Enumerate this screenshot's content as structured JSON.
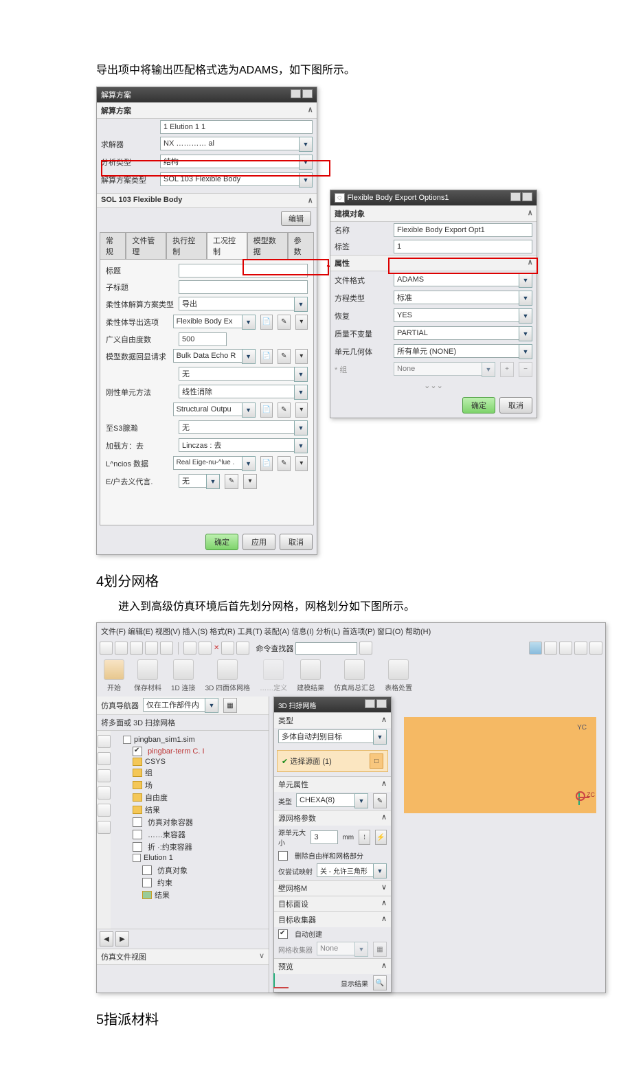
{
  "doc": {
    "intro": "导出项中将输出匹配格式选为ADAMS，如下图所示。",
    "h2_mesh": "4划分网格",
    "mesh_para": "进入到高级仿真环境后首先划分网格，网格划分如下图所示。",
    "h2_mat": "5指派材料"
  },
  "dlg1": {
    "title": "解算方案",
    "section": "解算方案",
    "nameField": "1 Elution 1  1",
    "solverLbl": "求解器",
    "solver": "NX ………… al",
    "analysisTypeLbl": "分析类型",
    "analysisType": "结构",
    "solutionTypeLbl": "解算方案类型",
    "solutionType": "SOL 103 Flexible Body",
    "sectionSol": "SOL 103 Flexible Body",
    "editBtn": "编辑",
    "tabs": [
      "常规",
      "文件管理",
      "执行控制",
      "工况控制",
      "模型数据",
      "参数"
    ],
    "activeTab": "工况控制",
    "rows": {
      "titleLbl": "标题",
      "subtitleLbl": "子标题",
      "flexSolTypeLbl": "柔性体解算方案类型",
      "flexSolType": "导出",
      "flexExportLbl": "柔性体导出选项",
      "flexExport": "Flexible Body Ex",
      "gdofLbl": "广义自由度数",
      "gdof": "500",
      "bulkEchoLbl": "模型数据回显请求",
      "bulkEcho": "Bulk Data Echo R",
      "none1": "无",
      "rigidElemLbl": "刚性单元方法",
      "rigidElem": "线性消除",
      "structOut": "Structural Outpu",
      "none2": "无",
      "toS3Lbl": "至S3腺瀚",
      "addMethodLbl": "加载方：去",
      "addMethod": "Linczas : 去",
      "lanczosLbl": "L^ncios 数据",
      "lanczos": "Real Eige-nu-^lue .",
      "userDefLbl": "E/户去义代言.",
      "none3": "无"
    },
    "footer": {
      "ok": "确定",
      "apply": "应用",
      "cancel": "取消"
    }
  },
  "dlg2": {
    "title": "Flexible Body Export Options1",
    "section_model": "建模对象",
    "nameLbl": "名称",
    "name": "Flexible Body Export Opt1",
    "labelLbl": "标签",
    "label": "1",
    "section_attr": "属性",
    "fileFmtLbl": "文件格式",
    "fileFmt": "ADAMS",
    "eqTypeLbl": "方程类型",
    "eqType": "标准",
    "recoverLbl": "恢复",
    "recover": "YES",
    "massInvLbl": "质量不变量",
    "massInv": "PARTIAL",
    "elemGeomLbl": "单元几何体",
    "elemGeom": "所有单元 (NONE)",
    "groupLbl": "* 组",
    "group": "None",
    "footer": {
      "ok": "确定",
      "cancel": "取消"
    }
  },
  "fig2": {
    "menubar": "文件(F)  编辑(E)  视图(V)  插入(S)  格式(R)  工具(T)  装配(A)  信息(I)  分析(L)  首选项(P)  窗口(O)  帮助(H)",
    "searchLbl": "命令查找器",
    "ribbon": [
      "开始",
      "保存材料",
      "1D 连接",
      "3D 四面体网格",
      "……定义",
      "建模结果",
      "仿真局总汇总",
      "表格处置"
    ],
    "filterLbl": "仿真导航器",
    "filterCombo": "仅在工作部件内",
    "treeTitle": "将多面或 3D 扫掠网格",
    "tree": {
      "root": "pingban_sim1.sim",
      "fem": "pingbar-term C.  I",
      "items": [
        "CSYS",
        "组",
        "场",
        "自由度",
        "结果",
        "仿真对象容器",
        "……束容器",
        "折 ·:约束容器"
      ],
      "sol": "Elution 1",
      "solChildren": [
        "仿真对象",
        "约束",
        "结果"
      ]
    },
    "bottom": "仿真文件视图",
    "meshDlg": {
      "title": "3D 扫掠网格",
      "typeSec": "类型",
      "typeVal": "多体自动判别目标",
      "selSec": "选择源面 (1)",
      "elemSec": "单元属性",
      "elemTypeLbl": "类型",
      "elemType": "CHEXA(8)",
      "paramSec": "源网格参数",
      "sizeLbl": "源单元大小",
      "size": "3",
      "unit": "mm",
      "chk1": "删除自由样和网格部分",
      "onlyTryLbl": "仅尝试映射",
      "onlyTry": "关 - 允许三角形",
      "wallSec": "壁网格M",
      "targetSec": "目标收集器",
      "autoChk": "自动创建",
      "meshCollLbl": "网格收集器",
      "meshColl": "None",
      "exportFaceLbl": "目标数集器",
      "previewSec": "预览",
      "resultBtn": "显示结果",
      "volMeshLbl": "目标面设"
    },
    "viewport": {
      "yc": "YC",
      "zc": "ZC"
    }
  }
}
